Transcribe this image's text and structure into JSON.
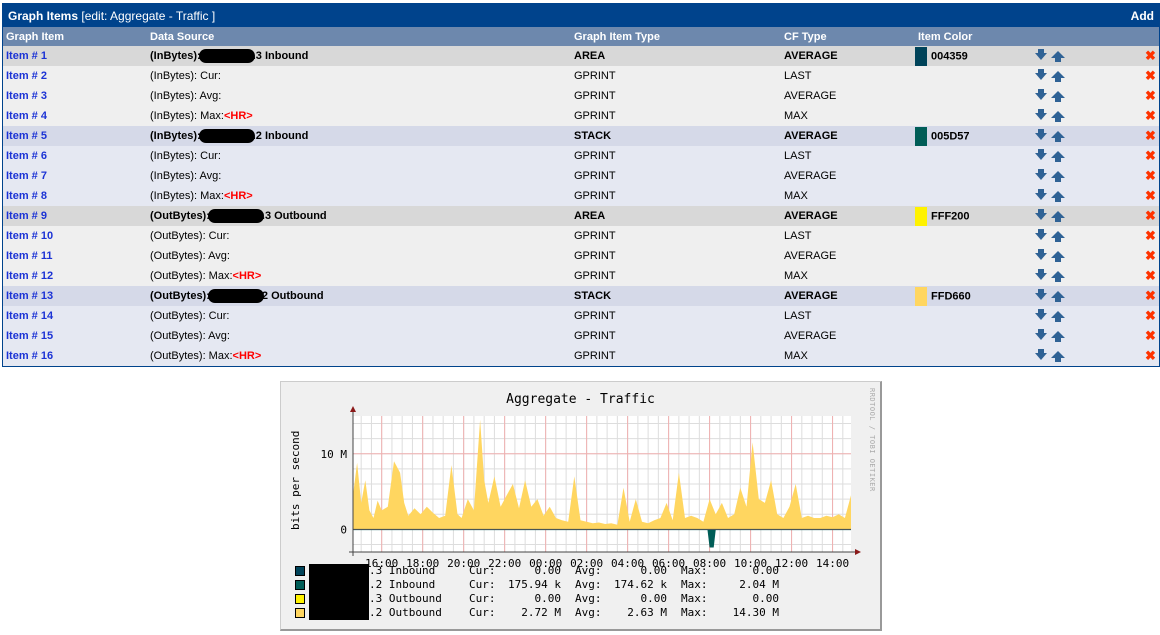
{
  "panel": {
    "title_bold": "Graph Items",
    "title_rest": " [edit: Aggregate - Traffic ]",
    "add_label": "Add",
    "columns": [
      "Graph Item",
      "Data Source",
      "Graph Item Type",
      "CF Type",
      "Item Color",
      ""
    ],
    "rows": [
      {
        "item": "Item # 1",
        "ds_prefix": "(InBytes):",
        "ds_suffix": ".3 Inbound",
        "redacted": true,
        "hr": "",
        "type": "AREA",
        "cf": "AVERAGE",
        "color": "004359",
        "main": true
      },
      {
        "item": "Item # 2",
        "ds_prefix": "(InBytes): Cur:",
        "ds_suffix": "",
        "redacted": false,
        "hr": "",
        "type": "GPRINT",
        "cf": "LAST",
        "color": "",
        "main": false
      },
      {
        "item": "Item # 3",
        "ds_prefix": "(InBytes): Avg:",
        "ds_suffix": "",
        "redacted": false,
        "hr": "",
        "type": "GPRINT",
        "cf": "AVERAGE",
        "color": "",
        "main": false
      },
      {
        "item": "Item # 4",
        "ds_prefix": "(InBytes): Max:",
        "ds_suffix": "",
        "redacted": false,
        "hr": "<HR>",
        "type": "GPRINT",
        "cf": "MAX",
        "color": "",
        "main": false
      },
      {
        "item": "Item # 5",
        "ds_prefix": "(InBytes):",
        "ds_suffix": ".2 Inbound",
        "redacted": true,
        "hr": "",
        "type": "STACK",
        "cf": "AVERAGE",
        "color": "005D57",
        "main": true
      },
      {
        "item": "Item # 6",
        "ds_prefix": "(InBytes): Cur:",
        "ds_suffix": "",
        "redacted": false,
        "hr": "",
        "type": "GPRINT",
        "cf": "LAST",
        "color": "",
        "main": false
      },
      {
        "item": "Item # 7",
        "ds_prefix": "(InBytes): Avg:",
        "ds_suffix": "",
        "redacted": false,
        "hr": "",
        "type": "GPRINT",
        "cf": "AVERAGE",
        "color": "",
        "main": false
      },
      {
        "item": "Item # 8",
        "ds_prefix": "(InBytes): Max:",
        "ds_suffix": "",
        "redacted": false,
        "hr": "<HR>",
        "type": "GPRINT",
        "cf": "MAX",
        "color": "",
        "main": false
      },
      {
        "item": "Item # 9",
        "ds_prefix": "(OutBytes):",
        "ds_suffix": ".3 Outbound",
        "redacted": true,
        "hr": "",
        "type": "AREA",
        "cf": "AVERAGE",
        "color": "FFF200",
        "main": true
      },
      {
        "item": "Item # 10",
        "ds_prefix": "(OutBytes): Cur:",
        "ds_suffix": "",
        "redacted": false,
        "hr": "",
        "type": "GPRINT",
        "cf": "LAST",
        "color": "",
        "main": false
      },
      {
        "item": "Item # 11",
        "ds_prefix": "(OutBytes): Avg:",
        "ds_suffix": "",
        "redacted": false,
        "hr": "",
        "type": "GPRINT",
        "cf": "AVERAGE",
        "color": "",
        "main": false
      },
      {
        "item": "Item # 12",
        "ds_prefix": "(OutBytes): Max:",
        "ds_suffix": "",
        "redacted": false,
        "hr": "<HR>",
        "type": "GPRINT",
        "cf": "MAX",
        "color": "",
        "main": false
      },
      {
        "item": "Item # 13",
        "ds_prefix": "(OutBytes):",
        "ds_suffix": "2 Outbound",
        "redacted": true,
        "hr": "",
        "type": "STACK",
        "cf": "AVERAGE",
        "color": "FFD660",
        "main": true
      },
      {
        "item": "Item # 14",
        "ds_prefix": "(OutBytes): Cur:",
        "ds_suffix": "",
        "redacted": false,
        "hr": "",
        "type": "GPRINT",
        "cf": "LAST",
        "color": "",
        "main": false
      },
      {
        "item": "Item # 15",
        "ds_prefix": "(OutBytes): Avg:",
        "ds_suffix": "",
        "redacted": false,
        "hr": "",
        "type": "GPRINT",
        "cf": "AVERAGE",
        "color": "",
        "main": false
      },
      {
        "item": "Item # 16",
        "ds_prefix": "(OutBytes): Max:",
        "ds_suffix": "",
        "redacted": false,
        "hr": "<HR>",
        "type": "GPRINT",
        "cf": "MAX",
        "color": "",
        "main": false
      }
    ],
    "icons": {
      "down": "arrow-down-icon",
      "up": "arrow-up-icon",
      "delete": "delete-x-icon"
    }
  },
  "graph": {
    "watermark": "RRDTOOL / TOBI OETIKER",
    "legend": [
      {
        "color": "#004359",
        "name": ".3 Inbound",
        "cur": "0.00",
        "avg": "0.00",
        "max": "0.00"
      },
      {
        "color": "#005D57",
        "name": ".2 Inbound",
        "cur": "175.94 k",
        "avg": "174.62 k",
        "max": "2.04 M"
      },
      {
        "color": "#FFF200",
        "name": ".3 Outbound",
        "cur": "0.00",
        "avg": "0.00",
        "max": "0.00"
      },
      {
        "color": "#FFD660",
        "name": ".2 Outbound",
        "cur": "2.72 M",
        "avg": "2.63 M",
        "max": "14.30 M"
      }
    ],
    "legend_labels": {
      "cur": "Cur:",
      "avg": "Avg:",
      "max": "Max:"
    }
  },
  "chart_data": {
    "type": "area",
    "title": "Aggregate - Traffic",
    "ylabel": "bits per second",
    "xlabel": "",
    "x_ticks": [
      "16:00",
      "18:00",
      "20:00",
      "22:00",
      "00:00",
      "02:00",
      "04:00",
      "06:00",
      "08:00",
      "10:00",
      "12:00",
      "14:00"
    ],
    "y_ticks": [
      {
        "value": 0,
        "label": "0"
      },
      {
        "value": 10000000,
        "label": "10 M"
      }
    ],
    "ylim": [
      -3000000,
      15000000
    ],
    "x_range_hours": [
      14.6,
      38.9
    ],
    "grid": true,
    "series": [
      {
        "name": ".2 Outbound",
        "color": "#FFD660",
        "type": "area",
        "hours": [
          14.6,
          14.8,
          15.0,
          15.2,
          15.4,
          15.6,
          15.8,
          16.0,
          16.3,
          16.6,
          16.9,
          17.1,
          17.3,
          17.6,
          17.9,
          18.2,
          18.5,
          18.8,
          19.1,
          19.4,
          19.7,
          19.9,
          20.2,
          20.5,
          20.8,
          21.0,
          21.2,
          21.5,
          21.8,
          22.1,
          22.4,
          22.7,
          23.0,
          23.3,
          23.6,
          23.9,
          24.2,
          24.5,
          24.8,
          25.1,
          25.4,
          25.7,
          26.0,
          26.3,
          26.6,
          26.9,
          27.2,
          27.5,
          27.8,
          28.1,
          28.4,
          28.7,
          29.0,
          29.3,
          29.6,
          29.9,
          30.2,
          30.5,
          30.8,
          31.1,
          31.4,
          31.7,
          32.0,
          32.3,
          32.6,
          32.9,
          33.2,
          33.5,
          33.8,
          34.1,
          34.4,
          34.7,
          35.0,
          35.3,
          35.6,
          35.9,
          36.2,
          36.5,
          36.8,
          37.1,
          37.4,
          37.7,
          38.0,
          38.3,
          38.6,
          38.9
        ],
        "values_M": [
          4.5,
          8.8,
          3.5,
          6.5,
          2.5,
          1.5,
          3.8,
          2.5,
          3.0,
          9.0,
          7.5,
          3.5,
          1.8,
          2.8,
          2.0,
          3.0,
          2.2,
          1.5,
          1.8,
          8.5,
          2.0,
          1.5,
          4.0,
          2.5,
          14.5,
          6.5,
          3.5,
          7.0,
          3.0,
          4.5,
          6.0,
          2.8,
          6.5,
          3.0,
          4.0,
          1.8,
          3.0,
          1.5,
          1.2,
          1.0,
          7.0,
          1.2,
          1.0,
          0.8,
          0.9,
          0.7,
          0.8,
          0.6,
          5.5,
          1.0,
          4.0,
          1.0,
          0.8,
          1.2,
          1.5,
          3.5,
          1.2,
          7.5,
          1.5,
          1.8,
          1.5,
          1.0,
          4.0,
          2.0,
          3.5,
          1.5,
          2.0,
          5.5,
          3.0,
          11.5,
          4.0,
          3.5,
          6.5,
          2.0,
          1.5,
          3.0,
          6.0,
          1.5,
          1.8,
          1.5,
          1.5,
          1.8,
          1.6,
          2.0,
          1.5,
          4.5
        ]
      },
      {
        "name": ".2 Inbound",
        "color": "#005D57",
        "type": "area",
        "hours": [
          14.6,
          31.9,
          32.0,
          32.1,
          32.2,
          32.3,
          38.9
        ],
        "values_M": [
          -0.1,
          -0.1,
          -2.4,
          -2.4,
          -2.4,
          -0.1,
          -0.1
        ]
      }
    ],
    "legend_position": "bottom-left"
  }
}
